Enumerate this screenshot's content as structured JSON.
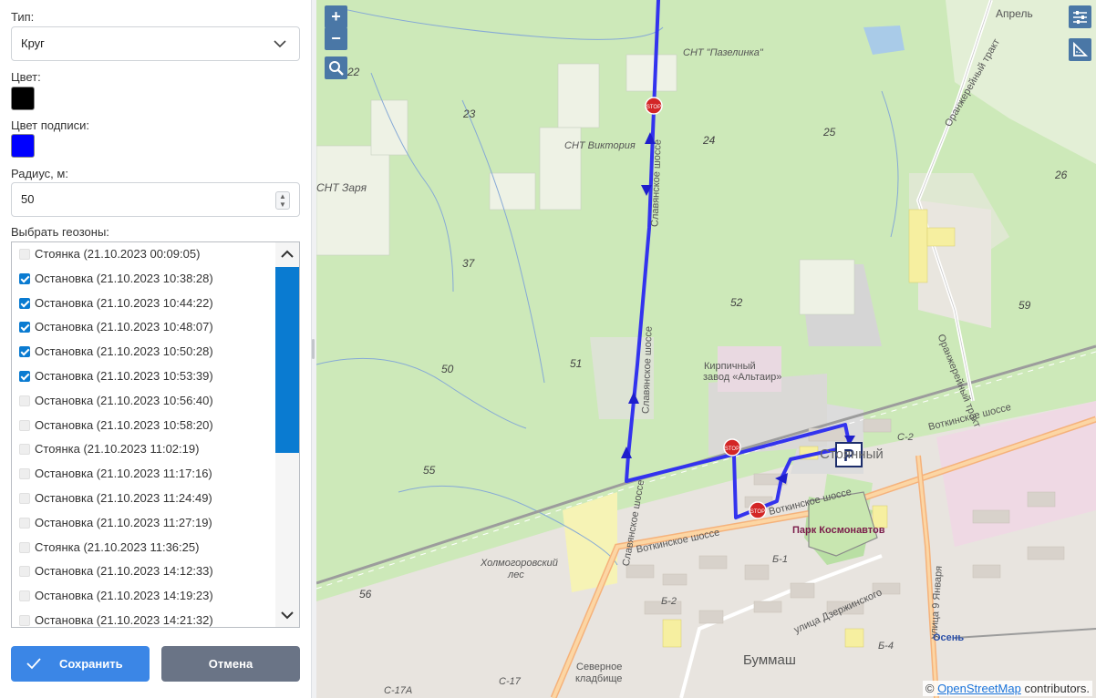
{
  "form": {
    "type_label": "Тип:",
    "type_value": "Круг",
    "color_label": "Цвет:",
    "color_value": "#000000",
    "label_color_label": "Цвет подписи:",
    "label_color_value": "#0000ff",
    "radius_label": "Радиус, м:",
    "radius_value": "50",
    "geozones_label": "Выбрать геозоны:"
  },
  "geozones": [
    {
      "label": "Стоянка (21.10.2023 00:09:05)",
      "checked": false
    },
    {
      "label": "Остановка (21.10.2023 10:38:28)",
      "checked": true
    },
    {
      "label": "Остановка (21.10.2023 10:44:22)",
      "checked": true
    },
    {
      "label": "Остановка (21.10.2023 10:48:07)",
      "checked": true
    },
    {
      "label": "Остановка (21.10.2023 10:50:28)",
      "checked": true
    },
    {
      "label": "Остановка (21.10.2023 10:53:39)",
      "checked": true
    },
    {
      "label": "Остановка (21.10.2023 10:56:40)",
      "checked": false
    },
    {
      "label": "Остановка (21.10.2023 10:58:20)",
      "checked": false
    },
    {
      "label": "Стоянка (21.10.2023 11:02:19)",
      "checked": false
    },
    {
      "label": "Остановка (21.10.2023 11:17:16)",
      "checked": false
    },
    {
      "label": "Остановка (21.10.2023 11:24:49)",
      "checked": false
    },
    {
      "label": "Остановка (21.10.2023 11:27:19)",
      "checked": false
    },
    {
      "label": "Стоянка (21.10.2023 11:36:25)",
      "checked": false
    },
    {
      "label": "Остановка (21.10.2023 14:12:33)",
      "checked": false
    },
    {
      "label": "Остановка (21.10.2023 14:19:23)",
      "checked": false
    },
    {
      "label": "Остановка (21.10.2023 14:21:32)",
      "checked": false
    }
  ],
  "buttons": {
    "save": "Сохранить",
    "cancel": "Отмена"
  },
  "map": {
    "zoom_in": "+",
    "zoom_out": "−",
    "labels": {
      "snt_pazelinka": "СНТ \"Пазелинка\"",
      "snt_viktoria": "СНТ Виктория",
      "snt_zarya": "СНТ Заря",
      "april": "Апрель",
      "kirpichny": "Кирпичный",
      "zavod": "завод «Альтаир»",
      "stoyanny": "Стоянный",
      "park": "Парк Космонавтов",
      "votkinskoe1": "Воткинское шоссе",
      "votkinskoe2": "Воткинское шоссе",
      "votkinskoe3": "Воткинское шоссе",
      "slavyanskoe1": "Славянское шоссе",
      "slavyanskoe2": "Славянское шоссе",
      "slavyanskoe3": "Славянское шоссе",
      "orangereyny1": "Оранжерейный тракт",
      "orangereyny2": "Оранжерейный тракт",
      "kholmogorsky": "Холмогоровский",
      "les": "лес",
      "severnoe": "Северное",
      "kladbishe": "кладбище",
      "dzerzhinskogo": "улица Дзержинского",
      "yanvarya": "улица 9 Января",
      "bummash": "Буммаш",
      "osen": "Осень",
      "b1": "Б-1",
      "b2": "Б-2",
      "b4": "Б-4",
      "s2": "С-2",
      "s17": "С-17",
      "s17a": "С-17А",
      "n22": "22",
      "n23": "23",
      "n24": "24",
      "n25": "25",
      "n26": "26",
      "n37": "37",
      "n50": "50",
      "n51": "51",
      "n52": "52",
      "n55": "55",
      "n56": "56",
      "n59": "59"
    },
    "attribution_prefix": "© ",
    "attribution_link": "OpenStreetMap",
    "attribution_suffix": " contributors.",
    "route_color": "#3333ee"
  }
}
